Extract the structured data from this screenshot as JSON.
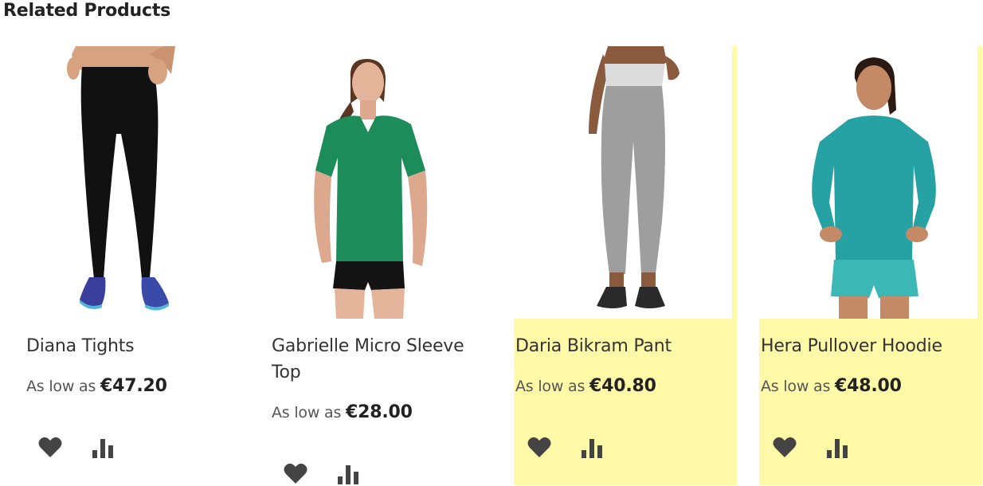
{
  "section": {
    "title": "Related Products"
  },
  "products": [
    {
      "name": "Diana Tights",
      "price_prefix": "As low as",
      "price": "€47.20",
      "image_icon": "model-black-leggings",
      "highlighted": false
    },
    {
      "name": "Gabrielle Micro Sleeve Top",
      "price_prefix": "As low as",
      "price": "€28.00",
      "image_icon": "model-green-tshirt",
      "highlighted": false
    },
    {
      "name": "Daria Bikram Pant",
      "price_prefix": "As low as",
      "price": "€40.80",
      "image_icon": "model-grey-capri-pants",
      "highlighted": true
    },
    {
      "name": "Hera Pullover Hoodie",
      "price_prefix": "As low as",
      "price": "€48.00",
      "image_icon": "model-teal-hoodie",
      "highlighted": true
    }
  ],
  "colors": {
    "highlight": "#fff9a8",
    "icon": "#444444",
    "text": "#333333"
  }
}
